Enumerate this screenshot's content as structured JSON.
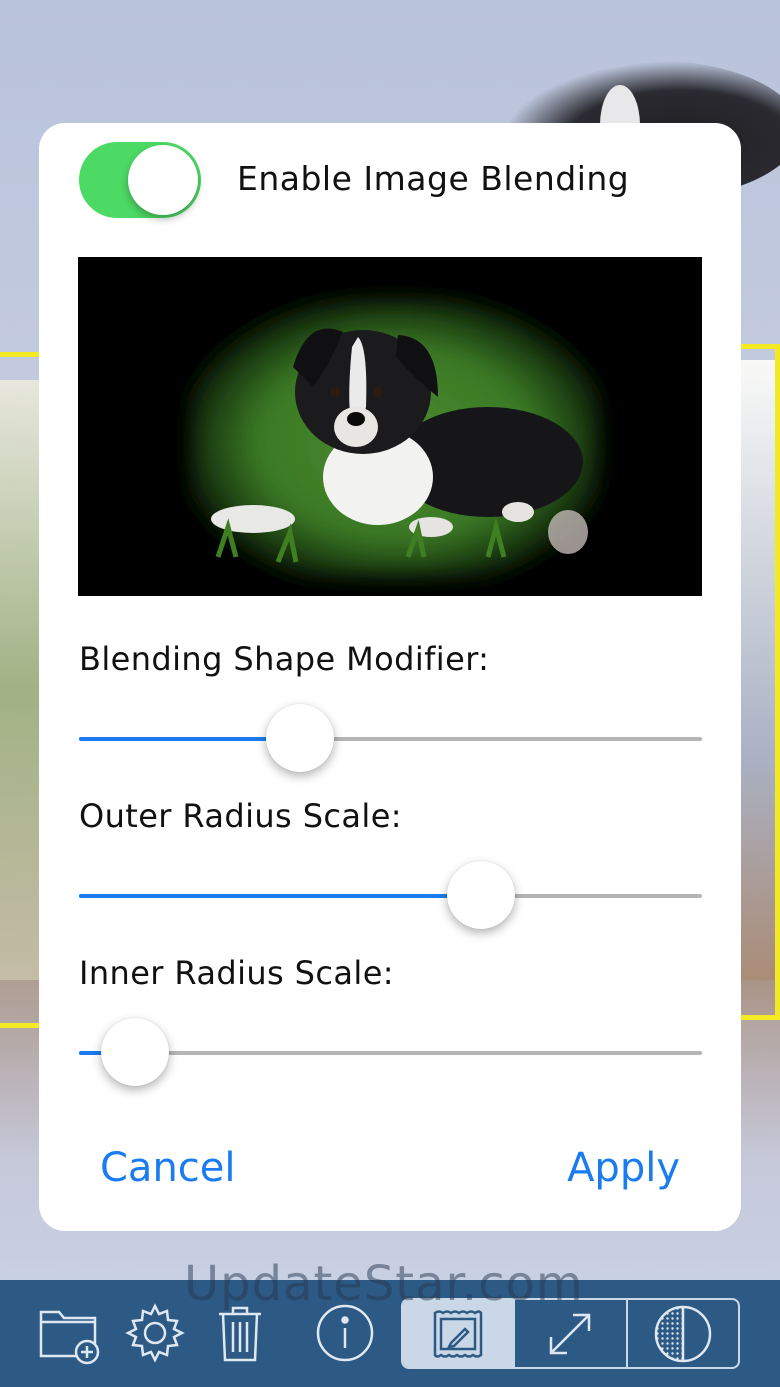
{
  "dialog": {
    "toggle": {
      "label": "Enable Image Blending",
      "on": true,
      "color": "#4cd964"
    },
    "sliders": [
      {
        "label": "Blending Shape Modifier:",
        "value": 0.355
      },
      {
        "label": "Outer Radius Scale:",
        "value": 0.645
      },
      {
        "label": "Inner Radius Scale:",
        "value": 0.09
      }
    ],
    "cancel_label": "Cancel",
    "apply_label": "Apply",
    "accent_color": "#1a7cf0"
  },
  "toolbar": {
    "background": "#2c5a84",
    "icons": [
      "new-folder-icon",
      "gear-icon",
      "trash-icon",
      "info-icon"
    ],
    "segments": [
      "frame-edit-icon",
      "resize-arrows-icon",
      "contrast-icon"
    ],
    "active_segment": 0
  },
  "watermark": "UpdateStar.com"
}
